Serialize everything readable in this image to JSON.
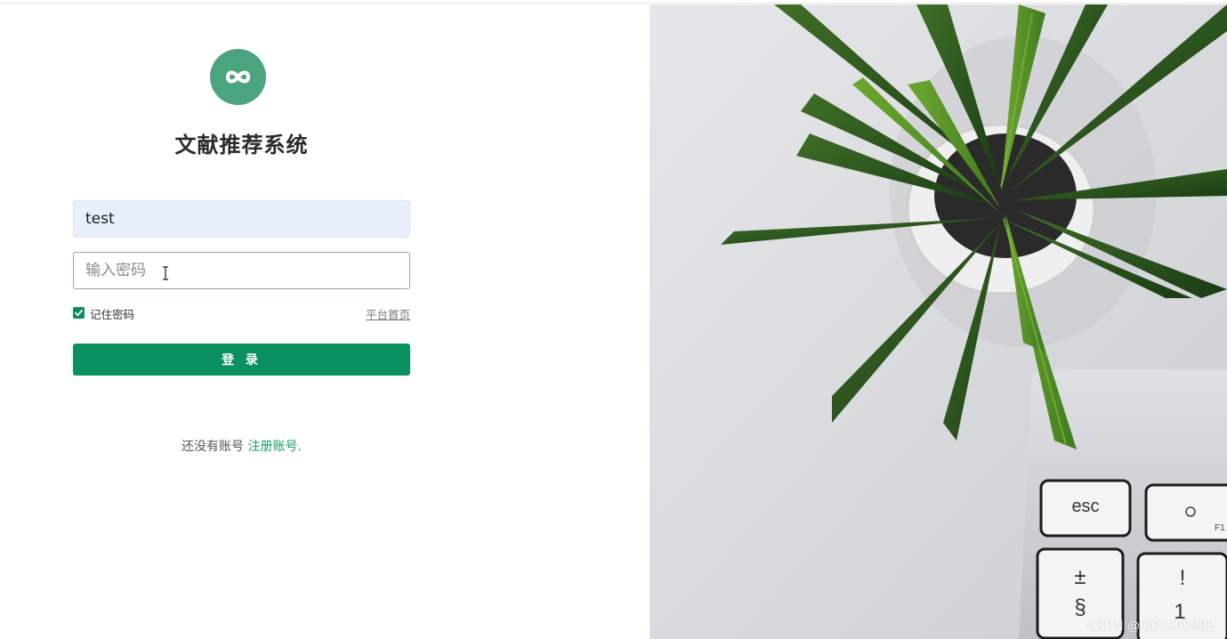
{
  "app": {
    "title": "文献推荐系统",
    "logo_icon": "infinity-icon",
    "brand_color": "#4aa57f"
  },
  "login_form": {
    "username_value": "test",
    "password_placeholder": "输入密码",
    "remember_label": "记住密码",
    "remember_checked": true,
    "home_link": "平台首页",
    "login_button": "登 录",
    "accent_color": "#0b915f"
  },
  "register": {
    "prompt": "还没有账号",
    "link": "注册账号",
    "suffix": "."
  },
  "hero": {
    "keyboard_keys": [
      {
        "label": "esc"
      },
      {
        "label": "F1",
        "icon": "brightness-icon"
      },
      {
        "top": "!",
        "bottom": "1"
      },
      {
        "top": "±",
        "bottom": "§"
      }
    ]
  },
  "watermark": "CSDN @l961903965"
}
